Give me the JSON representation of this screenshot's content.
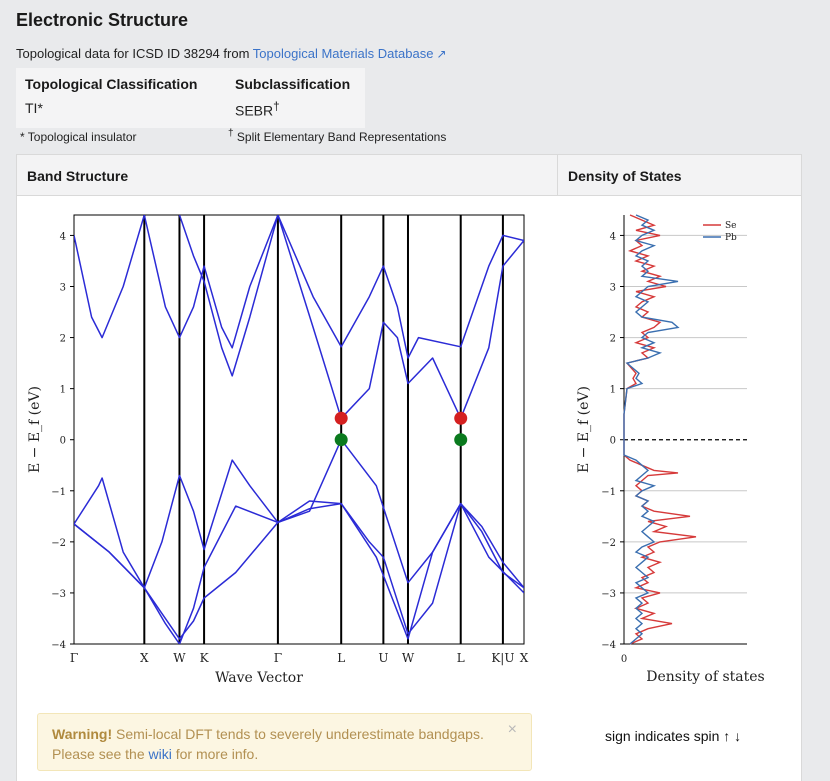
{
  "title": "Electronic Structure",
  "subtitle_text": "Topological data for ICSD ID 38294 from ",
  "subtitle_link": "Topological Materials Database",
  "classification": {
    "col1_header": "Topological Classification",
    "col1_value": "TI*",
    "col2_header": "Subclassification",
    "col2_value": "SEBR",
    "col2_sup": "†",
    "note1": "* Topological insulator",
    "note2_mark": "†",
    "note2": "Split Elementary Band Representations"
  },
  "panels": {
    "band_header": "Band Structure",
    "dos_header": "Density of States"
  },
  "warning": {
    "strong": "Warning!",
    "text": " Semi-local DFT tends to severely underestimate bandgaps. Please see the ",
    "link": "wiki",
    "tail": " for more info.",
    "close": "×"
  },
  "spin_note": "sign indicates spin ↑ ↓",
  "chart_data": [
    {
      "type": "line",
      "title": "",
      "xlabel": "Wave Vector",
      "ylabel": "E − E_f (eV)",
      "ylim": [
        -4,
        4.4
      ],
      "yticks": [
        -4,
        -3,
        -2,
        -1,
        0,
        1,
        2,
        3,
        4
      ],
      "kpoints": [
        {
          "label": "Γ",
          "k": 0
        },
        {
          "label": "X",
          "k": 1.0
        },
        {
          "label": "W",
          "k": 1.5
        },
        {
          "label": "K",
          "k": 1.85
        },
        {
          "label": "Γ",
          "k": 2.9
        },
        {
          "label": "L",
          "k": 3.8
        },
        {
          "label": "U",
          "k": 4.4
        },
        {
          "label": "W",
          "k": 4.75
        },
        {
          "label": "L",
          "k": 5.5
        },
        {
          "label": "K|U",
          "k": 6.1
        },
        {
          "label": "X",
          "k": 6.4
        }
      ],
      "series": [
        {
          "points": [
            [
              0,
              -1.65
            ],
            [
              0.5,
              -2.2
            ],
            [
              1.0,
              -2.9
            ],
            [
              1.25,
              -3.4
            ],
            [
              1.5,
              -3.9
            ],
            [
              1.7,
              -3.55
            ],
            [
              1.85,
              -3.1
            ],
            [
              2.3,
              -2.6
            ],
            [
              2.9,
              -1.62
            ],
            [
              3.35,
              -1.4
            ],
            [
              3.8,
              0.0
            ],
            [
              4.3,
              -0.9
            ],
            [
              4.75,
              -2.8
            ],
            [
              5.1,
              -2.2
            ],
            [
              5.5,
              -1.25
            ],
            [
              5.8,
              -1.8
            ],
            [
              6.1,
              -2.6
            ],
            [
              6.4,
              -2.9
            ]
          ]
        },
        {
          "points": [
            [
              0,
              -1.65
            ],
            [
              0.35,
              -0.9
            ],
            [
              0.4,
              -0.75
            ],
            [
              0.7,
              -2.2
            ],
            [
              1.0,
              -2.9
            ],
            [
              1.25,
              -2.0
            ],
            [
              1.5,
              -0.7
            ],
            [
              1.7,
              -1.4
            ],
            [
              1.85,
              -2.15
            ],
            [
              2.25,
              -0.4
            ],
            [
              2.5,
              -0.9
            ],
            [
              2.9,
              -1.62
            ],
            [
              3.35,
              -1.35
            ],
            [
              3.8,
              -1.25
            ],
            [
              4.3,
              -2.3
            ],
            [
              4.75,
              -3.9
            ],
            [
              5.1,
              -2.2
            ],
            [
              5.5,
              -1.25
            ],
            [
              5.8,
              -1.7
            ],
            [
              6.1,
              -2.4
            ],
            [
              6.4,
              -2.9
            ]
          ]
        },
        {
          "points": [
            [
              0,
              -1.65
            ],
            [
              0.5,
              -2.2
            ],
            [
              1.0,
              -2.9
            ],
            [
              1.3,
              -3.6
            ],
            [
              1.5,
              -4.0
            ],
            [
              1.7,
              -3.3
            ],
            [
              1.85,
              -2.5
            ],
            [
              2.3,
              -1.3
            ],
            [
              2.9,
              -1.62
            ],
            [
              3.35,
              -1.2
            ],
            [
              3.8,
              -1.25
            ],
            [
              4.2,
              -2.0
            ],
            [
              4.4,
              -2.3
            ],
            [
              4.75,
              -3.8
            ],
            [
              5.1,
              -3.2
            ],
            [
              5.5,
              -1.25
            ],
            [
              5.9,
              -2.3
            ],
            [
              6.4,
              -3.0
            ]
          ]
        },
        {
          "points": [
            [
              0,
              4.0
            ],
            [
              0.25,
              2.4
            ],
            [
              0.4,
              2.0
            ],
            [
              0.7,
              3.0
            ],
            [
              1.0,
              4.4
            ]
          ]
        },
        {
          "points": [
            [
              1.0,
              4.4
            ],
            [
              1.3,
              2.6
            ],
            [
              1.5,
              2.0
            ],
            [
              1.7,
              2.6
            ],
            [
              1.85,
              3.4
            ],
            [
              2.1,
              2.2
            ],
            [
              2.25,
              1.8
            ],
            [
              2.5,
              3.0
            ],
            [
              2.9,
              4.4
            ]
          ]
        },
        {
          "points": [
            [
              1.5,
              4.4
            ],
            [
              1.7,
              3.6
            ],
            [
              1.85,
              3.1
            ],
            [
              2.1,
              1.8
            ],
            [
              2.25,
              1.25
            ],
            [
              2.5,
              2.4
            ],
            [
              2.9,
              4.4
            ]
          ]
        },
        {
          "points": [
            [
              2.9,
              4.4
            ],
            [
              3.4,
              2.2
            ],
            [
              3.8,
              0.42
            ],
            [
              4.2,
              1.0
            ],
            [
              4.4,
              2.3
            ],
            [
              4.6,
              2.0
            ],
            [
              4.75,
              1.1
            ],
            [
              5.1,
              1.6
            ],
            [
              5.5,
              0.42
            ],
            [
              5.9,
              1.8
            ],
            [
              6.1,
              3.4
            ],
            [
              6.4,
              3.9
            ]
          ]
        },
        {
          "points": [
            [
              2.9,
              4.4
            ],
            [
              3.4,
              2.8
            ],
            [
              3.8,
              1.82
            ],
            [
              4.2,
              2.8
            ],
            [
              4.4,
              3.4
            ],
            [
              4.6,
              2.6
            ],
            [
              4.75,
              1.6
            ],
            [
              4.9,
              2.0
            ],
            [
              5.5,
              1.82
            ],
            [
              5.9,
              3.4
            ],
            [
              6.1,
              4.0
            ],
            [
              6.4,
              3.9
            ]
          ]
        }
      ],
      "markers": [
        {
          "k": 3.8,
          "e": 0.42,
          "color": "#d42020"
        },
        {
          "k": 3.8,
          "e": 0.0,
          "color": "#0a7a1e"
        },
        {
          "k": 5.5,
          "e": 0.42,
          "color": "#d42020"
        },
        {
          "k": 5.5,
          "e": 0.0,
          "color": "#0a7a1e"
        }
      ],
      "band_color": "#2b2bd6"
    },
    {
      "type": "line",
      "title": "",
      "xlabel": "Density of states",
      "ylabel": "E − E_f (eV)",
      "ylim": [
        -4,
        4.4
      ],
      "yticks": [
        -4,
        -3,
        -2,
        -1,
        0,
        1,
        2,
        3,
        4
      ],
      "xticks": [
        0
      ],
      "legend_position": "top-right",
      "series": [
        {
          "name": "Se",
          "color": "#d63a3a",
          "points": [
            [
              4.4,
              0.1
            ],
            [
              4.3,
              0.3
            ],
            [
              4.2,
              0.5
            ],
            [
              4.1,
              0.2
            ],
            [
              4.0,
              0.6
            ],
            [
              3.9,
              0.2
            ],
            [
              3.8,
              0.3
            ],
            [
              3.7,
              0.1
            ],
            [
              3.6,
              0.4
            ],
            [
              3.5,
              0.2
            ],
            [
              3.4,
              0.5
            ],
            [
              3.3,
              0.3
            ],
            [
              3.2,
              0.6
            ],
            [
              3.1,
              0.4
            ],
            [
              3.0,
              0.7
            ],
            [
              2.9,
              0.2
            ],
            [
              2.8,
              0.5
            ],
            [
              2.7,
              0.3
            ],
            [
              2.6,
              0.2
            ],
            [
              2.5,
              0.4
            ],
            [
              2.4,
              0.3
            ],
            [
              2.3,
              0.6
            ],
            [
              2.2,
              0.5
            ],
            [
              2.1,
              0.3
            ],
            [
              2.0,
              0.4
            ],
            [
              1.9,
              0.2
            ],
            [
              1.8,
              0.5
            ],
            [
              1.7,
              0.3
            ],
            [
              1.6,
              0.4
            ],
            [
              1.5,
              0.05
            ],
            [
              1.3,
              0.2
            ],
            [
              1.2,
              0.15
            ],
            [
              1.1,
              0.2
            ],
            [
              1.0,
              0.05
            ],
            [
              0.5,
              0.0
            ],
            [
              -0.3,
              0.0
            ],
            [
              -0.4,
              0.1
            ],
            [
              -0.5,
              0.3
            ],
            [
              -0.6,
              0.5
            ],
            [
              -0.65,
              0.9
            ],
            [
              -0.7,
              0.4
            ],
            [
              -0.8,
              0.3
            ],
            [
              -0.9,
              0.2
            ],
            [
              -1.0,
              0.3
            ],
            [
              -1.1,
              0.2
            ],
            [
              -1.2,
              0.4
            ],
            [
              -1.3,
              0.3
            ],
            [
              -1.4,
              0.5
            ],
            [
              -1.5,
              1.1
            ],
            [
              -1.6,
              0.4
            ],
            [
              -1.7,
              0.7
            ],
            [
              -1.8,
              0.5
            ],
            [
              -1.9,
              1.2
            ],
            [
              -2.0,
              0.6
            ],
            [
              -2.1,
              0.4
            ],
            [
              -2.2,
              0.5
            ],
            [
              -2.3,
              0.3
            ],
            [
              -2.4,
              0.6
            ],
            [
              -2.5,
              0.4
            ],
            [
              -2.6,
              0.5
            ],
            [
              -2.7,
              0.3
            ],
            [
              -2.8,
              0.4
            ],
            [
              -2.9,
              0.2
            ],
            [
              -3.0,
              0.6
            ],
            [
              -3.1,
              0.3
            ],
            [
              -3.2,
              0.4
            ],
            [
              -3.3,
              0.2
            ],
            [
              -3.4,
              0.5
            ],
            [
              -3.5,
              0.3
            ],
            [
              -3.6,
              0.8
            ],
            [
              -3.7,
              0.4
            ],
            [
              -3.8,
              0.2
            ],
            [
              -3.9,
              0.3
            ],
            [
              -4.0,
              0.1
            ]
          ]
        },
        {
          "name": "Pb",
          "color": "#3a6fb0",
          "points": [
            [
              4.4,
              0.2
            ],
            [
              4.3,
              0.4
            ],
            [
              4.2,
              0.3
            ],
            [
              4.1,
              0.5
            ],
            [
              4.0,
              0.3
            ],
            [
              3.9,
              0.2
            ],
            [
              3.8,
              0.5
            ],
            [
              3.7,
              0.3
            ],
            [
              3.6,
              0.2
            ],
            [
              3.5,
              0.4
            ],
            [
              3.4,
              0.3
            ],
            [
              3.3,
              0.4
            ],
            [
              3.2,
              0.3
            ],
            [
              3.1,
              0.9
            ],
            [
              3.0,
              0.4
            ],
            [
              2.9,
              0.3
            ],
            [
              2.8,
              0.2
            ],
            [
              2.7,
              0.4
            ],
            [
              2.6,
              0.3
            ],
            [
              2.5,
              0.2
            ],
            [
              2.4,
              0.3
            ],
            [
              2.3,
              0.8
            ],
            [
              2.2,
              0.9
            ],
            [
              2.1,
              0.4
            ],
            [
              2.0,
              0.3
            ],
            [
              1.9,
              0.5
            ],
            [
              1.8,
              0.3
            ],
            [
              1.7,
              0.6
            ],
            [
              1.6,
              0.4
            ],
            [
              1.5,
              0.05
            ],
            [
              1.3,
              0.25
            ],
            [
              1.2,
              0.2
            ],
            [
              1.1,
              0.3
            ],
            [
              1.0,
              0.05
            ],
            [
              0.5,
              0.0
            ],
            [
              -0.3,
              0.0
            ],
            [
              -0.4,
              0.2
            ],
            [
              -0.5,
              0.3
            ],
            [
              -0.6,
              0.4
            ],
            [
              -0.7,
              0.3
            ],
            [
              -0.8,
              0.2
            ],
            [
              -0.9,
              0.5
            ],
            [
              -1.0,
              0.3
            ],
            [
              -1.1,
              0.2
            ],
            [
              -1.2,
              0.4
            ],
            [
              -1.3,
              0.3
            ],
            [
              -1.4,
              0.4
            ],
            [
              -1.5,
              0.3
            ],
            [
              -1.6,
              0.5
            ],
            [
              -1.7,
              0.4
            ],
            [
              -1.8,
              0.3
            ],
            [
              -1.9,
              0.4
            ],
            [
              -2.0,
              0.5
            ],
            [
              -2.1,
              0.3
            ],
            [
              -2.2,
              0.2
            ],
            [
              -2.3,
              0.4
            ],
            [
              -2.4,
              0.3
            ],
            [
              -2.5,
              0.2
            ],
            [
              -2.6,
              0.3
            ],
            [
              -2.7,
              0.4
            ],
            [
              -2.8,
              0.2
            ],
            [
              -2.9,
              0.3
            ],
            [
              -3.0,
              0.4
            ],
            [
              -3.1,
              0.2
            ],
            [
              -3.2,
              0.3
            ],
            [
              -3.3,
              0.2
            ],
            [
              -3.4,
              0.3
            ],
            [
              -3.5,
              0.2
            ],
            [
              -3.6,
              0.3
            ],
            [
              -3.7,
              0.2
            ],
            [
              -3.8,
              0.3
            ],
            [
              -3.9,
              0.2
            ],
            [
              -4.0,
              0.1
            ]
          ]
        }
      ],
      "fermi_line": "dashed"
    }
  ]
}
